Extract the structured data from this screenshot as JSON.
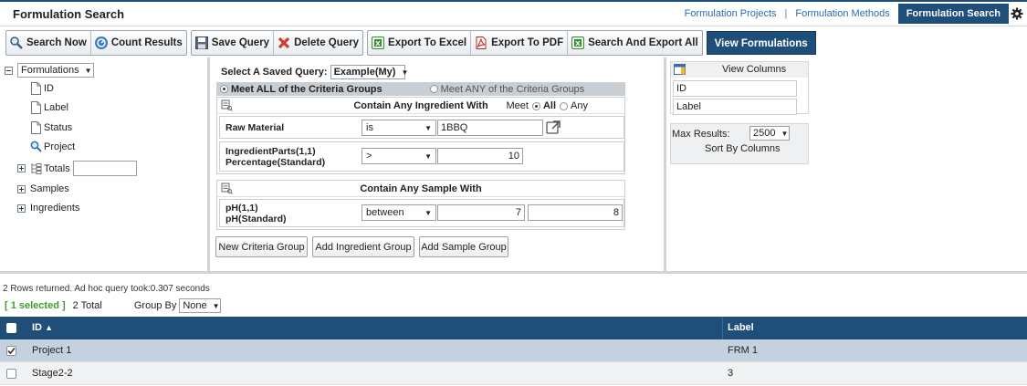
{
  "header": {
    "title": "Formulation Search",
    "nav": [
      {
        "label": "Formulation Projects"
      },
      {
        "label": "Formulation Methods"
      },
      {
        "label": "Formulation Search"
      }
    ],
    "nav_separator": "|"
  },
  "toolbar": {
    "search_now": "Search Now",
    "count_results": "Count Results",
    "save_query": "Save Query",
    "delete_query": "Delete Query",
    "export_excel": "Export To Excel",
    "export_pdf": "Export To PDF",
    "search_export_all": "Search And Export All",
    "view_formulations": "View Formulations"
  },
  "tree": {
    "root_select": "Formulations",
    "items": [
      "ID",
      "Label",
      "Status",
      "Project",
      "Totals",
      "Samples",
      "Ingredients"
    ]
  },
  "query": {
    "saved_query_label": "Select A Saved Query:",
    "saved_query_value": "Example(My)",
    "meet_all": "Meet ALL of the Criteria Groups",
    "meet_any": "Meet ANY of the Criteria Groups",
    "ingredient_group": {
      "title": "Contain Any Ingredient With",
      "meet_label": "Meet",
      "all_label": "All",
      "any_label": "Any",
      "rows": [
        {
          "label1": "Raw Material",
          "label2": "",
          "operator": "is",
          "value1": "1BBQ",
          "value2": ""
        },
        {
          "label1": "IngredientParts(1,1)",
          "label2": "Percentage(Standard)",
          "operator": ">",
          "value1": "10",
          "value2": ""
        }
      ]
    },
    "sample_group": {
      "title": "Contain Any Sample With",
      "rows": [
        {
          "label1": "pH(1,1)",
          "label2": "pH(Standard)",
          "operator": "between",
          "value1": "7",
          "value2": "8"
        }
      ]
    },
    "buttons": {
      "new_criteria_group": "New Criteria Group",
      "add_ingredient_group": "Add Ingredient Group",
      "add_sample_group": "Add Sample Group"
    }
  },
  "columns_panel": {
    "title": "View Columns",
    "items": [
      "ID",
      "Label"
    ],
    "max_results_label": "Max Results:",
    "max_results_value": "2500",
    "sort_by_label": "Sort By Columns"
  },
  "results": {
    "stats": "2 Rows returned. Ad hoc query took:0.307 seconds",
    "selected": "[ 1 selected ]",
    "total": "2 Total",
    "group_by_label": "Group By",
    "group_by_value": "None",
    "columns": [
      "ID",
      "Label"
    ],
    "sort_indicator": "▲",
    "rows": [
      {
        "id": "Project 1",
        "label": "FRM 1",
        "checked": true
      },
      {
        "id": "Stage2-2",
        "label": "3",
        "checked": false
      }
    ]
  },
  "colors": {
    "accent": "#1f4e79",
    "link": "#2a6bb0",
    "selected_text": "#3e9c2e",
    "selected_row": "#c4d2e0"
  },
  "icons": [
    "gear-icon",
    "search-icon",
    "count-icon",
    "save-icon",
    "delete-icon",
    "excel-icon",
    "pdf-icon",
    "export-all-icon",
    "document-icon",
    "magnifier-icon",
    "criteria-group-icon",
    "external-link-icon",
    "columns-icon"
  ]
}
